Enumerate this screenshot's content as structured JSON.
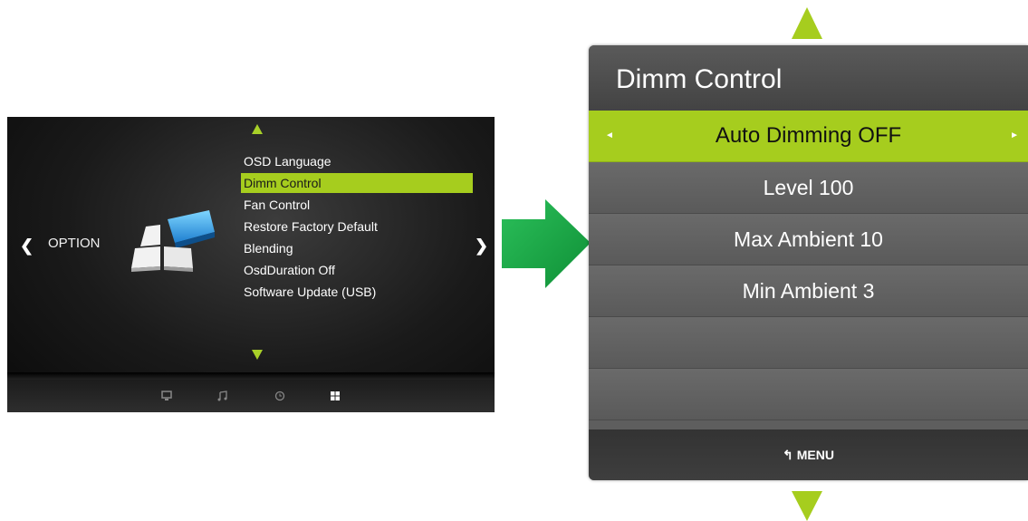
{
  "left_panel": {
    "section_label": "OPTION",
    "nav_left_glyph": "❮",
    "nav_right_glyph": "❯",
    "menu_items": [
      {
        "label": "OSD Language",
        "active": false
      },
      {
        "label": "Dimm Control",
        "active": true
      },
      {
        "label": "Fan Control",
        "active": false
      },
      {
        "label": "Restore Factory Default",
        "active": false
      },
      {
        "label": "Blending",
        "active": false
      },
      {
        "label": "OsdDuration Off",
        "active": false
      },
      {
        "label": "Software Update (USB)",
        "active": false
      }
    ],
    "bottom_icons": [
      "monitor-icon",
      "music-icon",
      "clock-icon",
      "option-grid-icon"
    ],
    "active_bottom_icon": "option-grid-icon"
  },
  "submenu": {
    "title": "Dimm Control",
    "rows": [
      {
        "label": "Auto Dimming OFF",
        "active": true
      },
      {
        "label": "Level 100",
        "active": false
      },
      {
        "label": "Max Ambient 10",
        "active": false
      },
      {
        "label": "Min Ambient 3",
        "active": false
      },
      {
        "label": "",
        "active": false
      },
      {
        "label": "",
        "active": false
      }
    ],
    "row_left_glyph": "◄",
    "row_right_glyph": "►",
    "footer_label": "MENU",
    "footer_icon_glyph": "↰"
  },
  "colors": {
    "accent_green": "#a6cd1e",
    "arrow_green": "#20a848",
    "panel_dark": "#1a1a1a",
    "submenu_gray": "#5e5e5e"
  }
}
